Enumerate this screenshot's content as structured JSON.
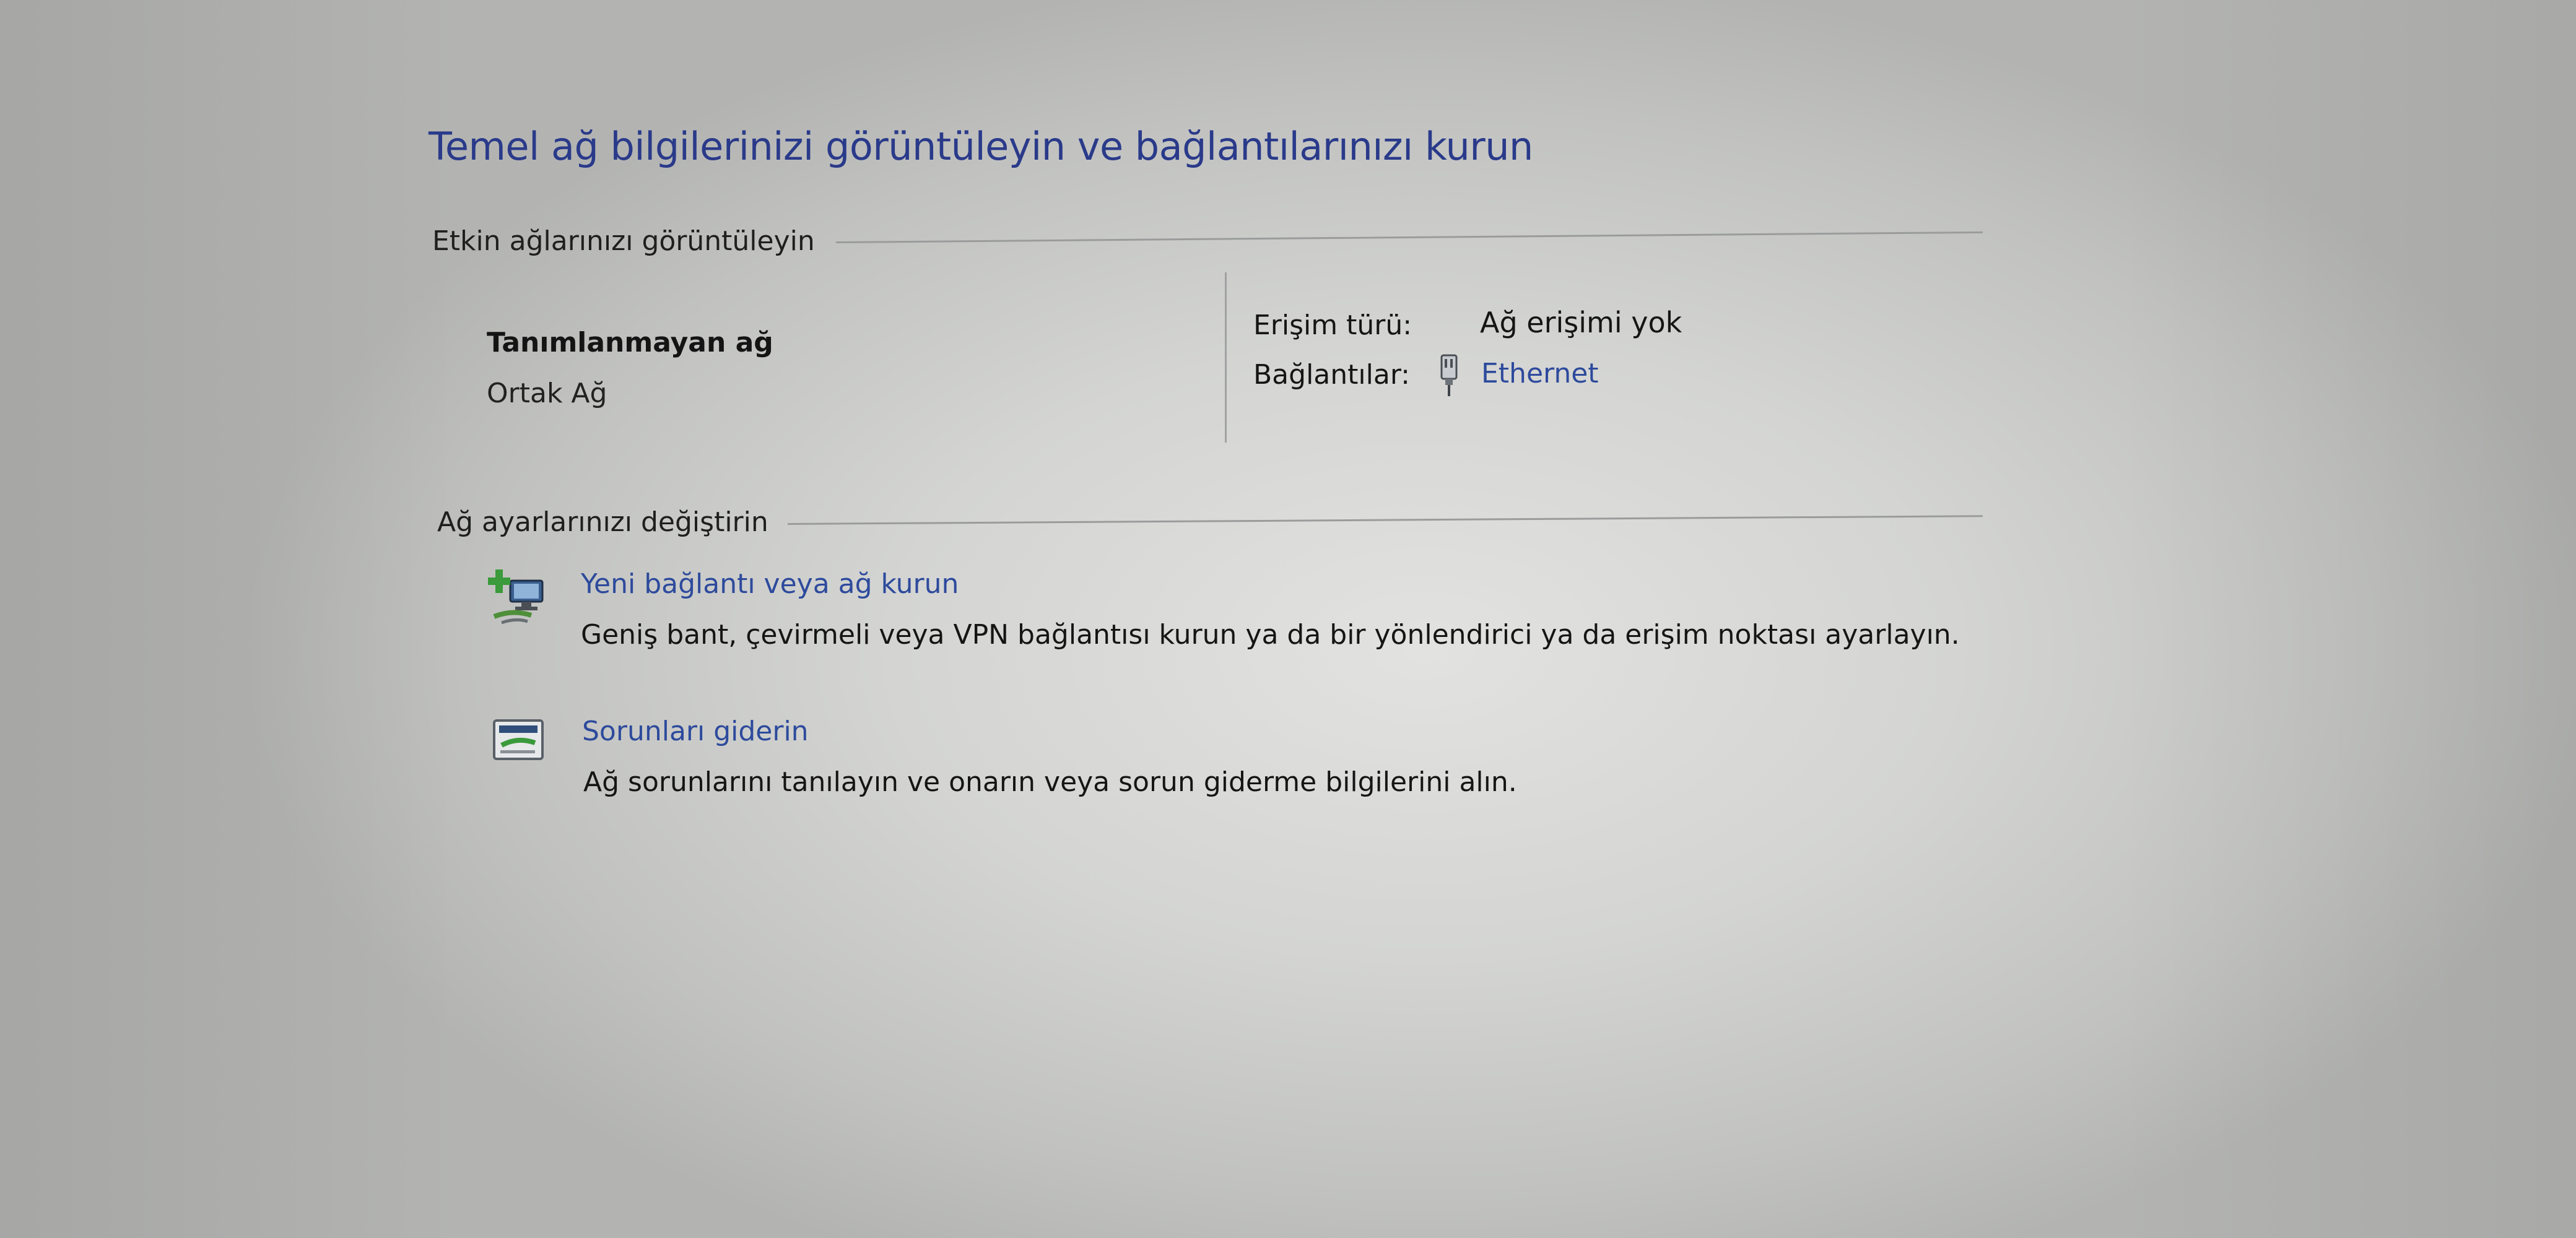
{
  "page": {
    "title": "Temel ağ bilgilerinizi görüntüleyin ve bağlantılarınızı kurun"
  },
  "active_networks": {
    "header": "Etkin ağlarınızı görüntüleyin",
    "network_name": "Tanımlanmayan ağ",
    "network_type": "Ortak Ağ",
    "access_type_label": "Erişim türü:",
    "access_type_value": "Ağ erişimi yok",
    "connections_label": "Bağlantılar:",
    "connection_icon": "ethernet-plug-icon",
    "connection_link": "Ethernet"
  },
  "change_settings": {
    "header": "Ağ ayarlarınızı değiştirin",
    "tasks": [
      {
        "icon": "new-connection-icon",
        "title": "Yeni bağlantı veya ağ kurun",
        "description": "Geniş bant, çevirmeli veya VPN bağlantısı kurun ya da bir yönlendirici ya da erişim noktası ayarlayın."
      },
      {
        "icon": "troubleshoot-icon",
        "title": "Sorunları giderin",
        "description": "Ağ sorunlarını tanılayın ve onarın veya sorun giderme bilgilerini alın."
      }
    ]
  },
  "colors": {
    "title": "#2a3a8a",
    "link": "#2d4a9c",
    "text": "#151515"
  }
}
